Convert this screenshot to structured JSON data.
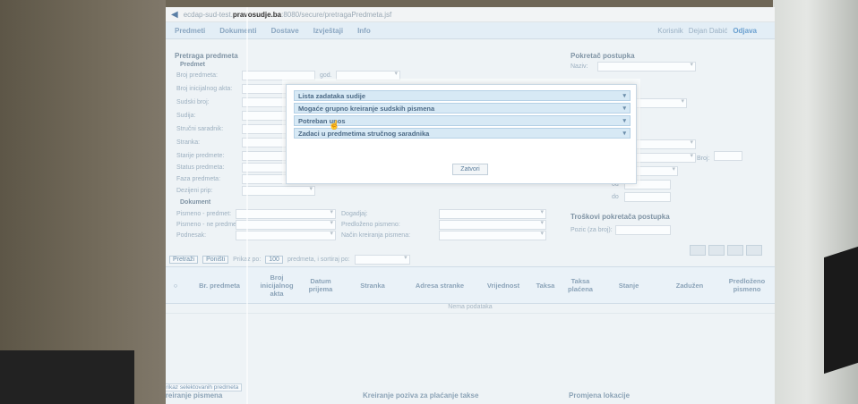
{
  "browser": {
    "url_prefix": "ecdap-sud-test.",
    "url_domain": "pravosudje.ba",
    "url_path": ":8080/secure/pretragaPredmeta.jsf"
  },
  "menu": {
    "items": [
      "Predmeti",
      "Dokumenti",
      "Dostave",
      "Izvještaji",
      "Info"
    ],
    "user_text": "Korisnik",
    "user_link": "Dejan Dabić",
    "odjava": "Odjava"
  },
  "search": {
    "title": "Pretraga predmeta",
    "predmet_header": "Predmet",
    "fields": [
      "Broj predmeta:",
      "Broj inicijalnog akta:",
      "Sudski broj:",
      "Sudija:",
      "Stručni saradnik:",
      "Stranka:",
      "Starije predmete:",
      "Status predmeta:",
      "Faza predmeta:",
      "Dezijeni prip:"
    ],
    "god_label": "god.",
    "dokument_header": "Dokument",
    "doc_fields": [
      "Pismeno - predmet:",
      "Pismeno - ne predmeti:",
      "Podnesak:"
    ],
    "doc_fields_2": [
      "Dogadjaj:",
      "Predloženo pismeno:",
      "Način kreiranja pismena:"
    ]
  },
  "right_panel": {
    "title": "Pokretač postupka",
    "nazivi_label": "Naziv:",
    "broj_label": "Broj:",
    "od_label": "od",
    "do_label": "do",
    "troskovi_title": "Troškovi pokretača postupka",
    "pozicija_label": "Pozic (za broj):"
  },
  "dialog": {
    "items": [
      "Lista zadataka sudije",
      "Mogaće grupno kreiranje sudskih pismena",
      "Potreban unos",
      "Zadaci u predmetima stručnog saradnika"
    ],
    "close": "Zatvori"
  },
  "pagebar": {
    "btn1": "Pretraži",
    "btn2": "Poništi",
    "prikaz": "Prikaz po:",
    "count": "100",
    "text": "predmeta, i sortiraj po:"
  },
  "table": {
    "headers": [
      "Br. predmeta",
      "Broj inicijalnog akta",
      "Datum prijema",
      "Stranka",
      "Adresa stranke",
      "Vrijednost",
      "Taksa",
      "Taksa plaćena",
      "Stanje",
      "Zadužen",
      "Predloženo pismeno"
    ],
    "empty": "Nema podataka"
  },
  "bottom": {
    "link": "Prikaz selektovanih predmeta",
    "left": "Kreiranje pismena",
    "mid": "Kreiranje poziva za plaćanje takse",
    "right": "Promjena lokacije"
  }
}
